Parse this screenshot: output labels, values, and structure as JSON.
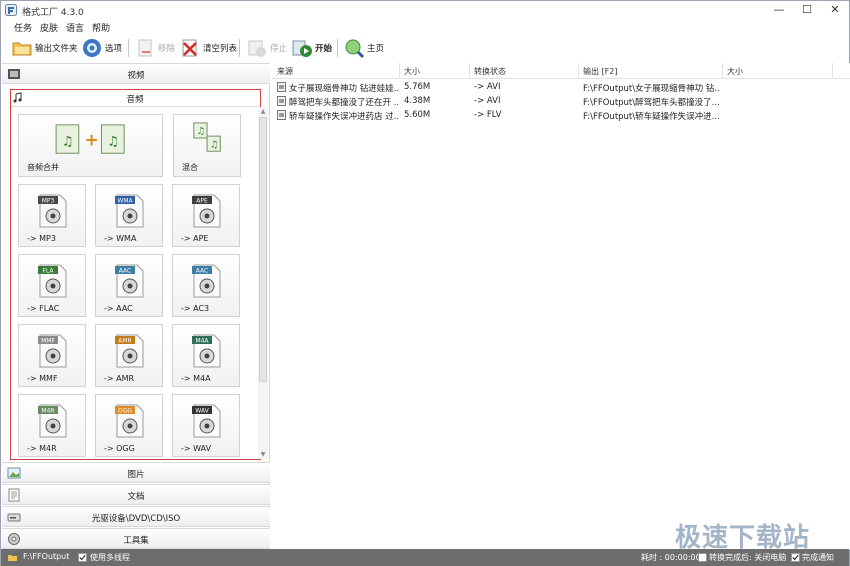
{
  "window": {
    "title": "格式工厂 4.3.0",
    "minimize_glyph": "—",
    "maximize_glyph": "☐",
    "close_glyph": "✕"
  },
  "menu": [
    "任务",
    "皮肤",
    "语言",
    "帮助"
  ],
  "toolbar": {
    "output_folder": "输出文件夹",
    "options": "选项",
    "remove": "移除",
    "clear_list": "清空列表",
    "stop": "停止",
    "start": "开始",
    "home": "主页"
  },
  "left_panel": {
    "categories": {
      "video": "视频",
      "audio": "音频",
      "picture": "图片",
      "document": "文档",
      "disc": "光驱设备\\DVD\\CD\\ISO",
      "tools": "工具集"
    },
    "audio_tiles": [
      {
        "label": "音频合并",
        "icon": "audio-merge-icon"
      },
      {
        "label": "混合",
        "icon": "audio-mix-icon"
      },
      {
        "label": "-> MP3",
        "badge": "MP3",
        "icon": "mp3-icon"
      },
      {
        "label": "-> WMA",
        "badge": "WMA",
        "icon": "wma-icon"
      },
      {
        "label": "-> APE",
        "badge": "APE",
        "icon": "ape-icon"
      },
      {
        "label": "-> FLAC",
        "badge": "FLA",
        "icon": "flac-icon"
      },
      {
        "label": "-> AAC",
        "badge": "AAC",
        "icon": "aac-icon"
      },
      {
        "label": "-> AC3",
        "badge": "AAC",
        "icon": "ac3-icon"
      },
      {
        "label": "-> MMF",
        "badge": "MMF",
        "icon": "mmf-icon"
      },
      {
        "label": "-> AMR",
        "badge": "AMR",
        "icon": "amr-icon"
      },
      {
        "label": "-> M4A",
        "badge": "M4A",
        "icon": "m4a-icon"
      },
      {
        "label": "-> M4R",
        "badge": "M4R",
        "icon": "m4r-icon"
      },
      {
        "label": "-> OGG",
        "badge": "OGG",
        "icon": "ogg-icon"
      },
      {
        "label": "-> WAV",
        "badge": "WAV",
        "icon": "wav-icon"
      }
    ]
  },
  "file_list": {
    "columns": [
      "来源",
      "大小",
      "转换状态",
      "输出 [F2]",
      "大小"
    ],
    "rows": [
      {
        "source": "女子展现缩骨神功 钻进娃娃...",
        "size": "5.76M",
        "status": "-> AVI",
        "output": "F:\\FFOutput\\女子展现缩骨神功 钻...",
        "out_size": ""
      },
      {
        "source": "醉驾把车头都撞没了还在开 ...",
        "size": "4.38M",
        "status": "-> AVI",
        "output": "F:\\FFOutput\\醉驾把车头都撞没了...",
        "out_size": ""
      },
      {
        "source": "轿车疑操作失误冲进药店 过...",
        "size": "5.60M",
        "status": "-> FLV",
        "output": "F:\\FFOutput\\轿车疑操作失误冲进...",
        "out_size": ""
      }
    ]
  },
  "status_bar": {
    "output_path": "F:\\FFOutput",
    "multithread": "使用多线程",
    "elapsed": "耗时 : 00:00:00",
    "after_convert": "转换完成后: 关闭电脑",
    "notify": "完成通知"
  },
  "watermark": "极速下载站",
  "colors": {
    "highlight_border": "#d6403a",
    "status_bar": "#6d6d6d",
    "start_icon": "#2e8b3a"
  }
}
